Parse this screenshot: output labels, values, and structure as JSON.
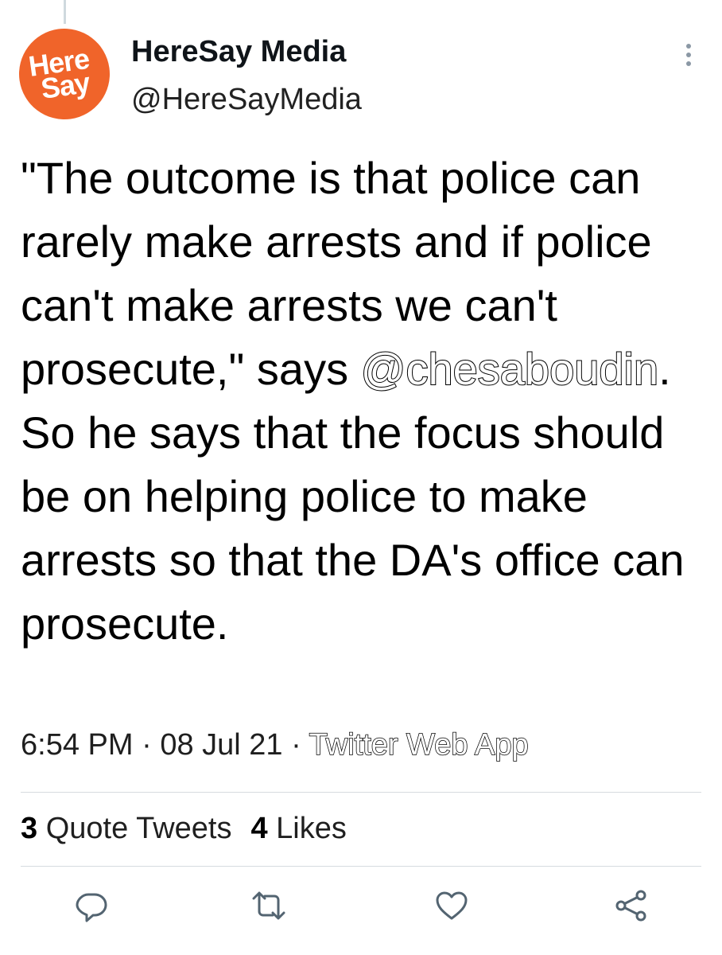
{
  "account": {
    "avatar_line1": "Here",
    "avatar_line2": "Say",
    "display_name": "HereSay Media",
    "handle": "@HereSayMedia",
    "avatar_color": "#f0642a"
  },
  "tweet": {
    "text_part1": "\"The outcome is that police can rarely make arrests and if police can't make arrests we can't prosecute,\" says ",
    "mention": "@chesaboudin",
    "text_part2": ". So he says that the focus should be on helping police to make arrests so that the DA's office can prosecute."
  },
  "meta": {
    "time": "6:54 PM",
    "separator": " · ",
    "date": "08 Jul 21",
    "source": "Twitter Web App"
  },
  "stats": {
    "quote_count": "3",
    "quote_label": " Quote Tweets",
    "like_count": "4",
    "like_label": " Likes"
  },
  "actions": {
    "reply_icon": "reply-icon",
    "retweet_icon": "retweet-icon",
    "like_icon": "heart-icon",
    "share_icon": "share-icon"
  },
  "colors": {
    "text": "#000000",
    "icon": "#536471",
    "divider": "#d6dbdf"
  }
}
